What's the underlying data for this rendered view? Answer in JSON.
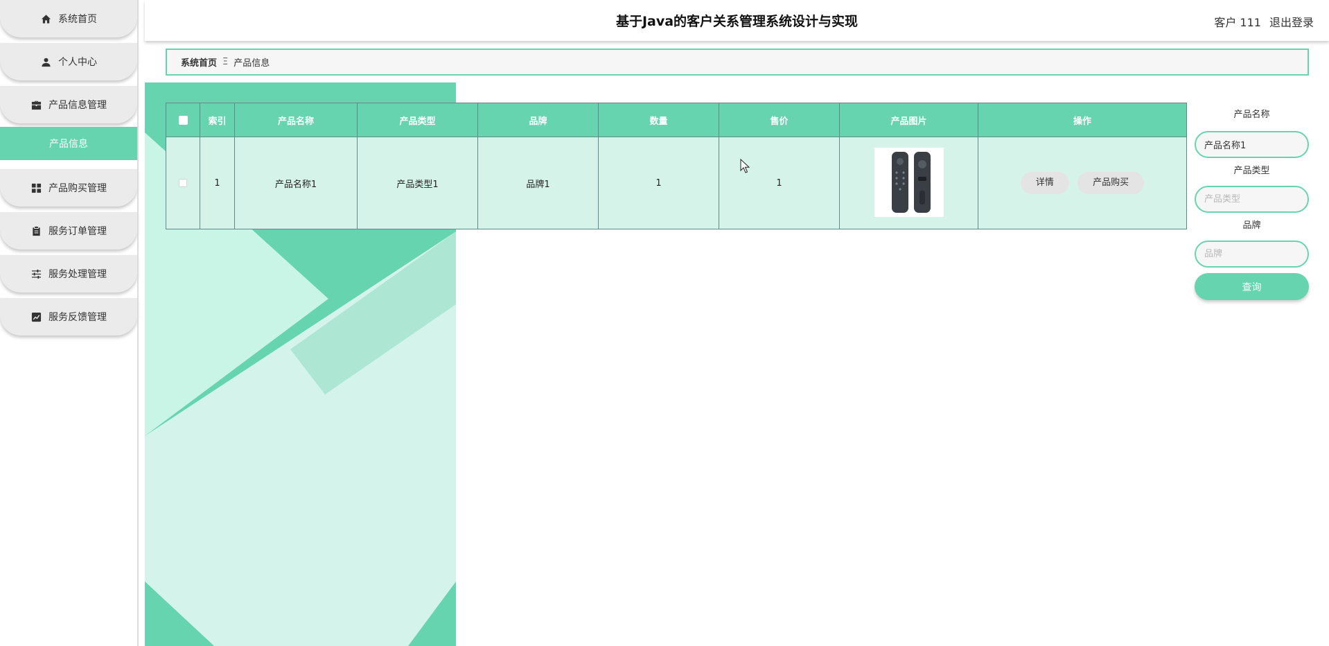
{
  "app": {
    "title": "基于Java的客户关系管理系统设计与实现",
    "user": "客户 111",
    "logout": "退出登录"
  },
  "sidebar": {
    "items": [
      {
        "label": "系统首页",
        "icon": "home-icon"
      },
      {
        "label": "个人中心",
        "icon": "person-icon"
      },
      {
        "label": "产品信息管理",
        "icon": "briefcase-icon"
      },
      {
        "label": "产品购买管理",
        "icon": "grid-icon"
      },
      {
        "label": "服务订单管理",
        "icon": "clipboard-icon"
      },
      {
        "label": "服务处理管理",
        "icon": "sliders-icon"
      },
      {
        "label": "服务反馈管理",
        "icon": "chart-icon"
      }
    ],
    "active_sub": "产品信息"
  },
  "breadcrumb": {
    "home": "系统首页",
    "separator": "Ξ",
    "current": "产品信息"
  },
  "table": {
    "headers": [
      "索引",
      "产品名称",
      "产品类型",
      "品牌",
      "数量",
      "售价",
      "产品图片",
      "操作"
    ],
    "rows": [
      {
        "index": "1",
        "name": "产品名称1",
        "type": "产品类型1",
        "brand": "品牌1",
        "quantity": "1",
        "price": "1",
        "image": "remote-control-image",
        "actions": [
          "详情",
          "产品购买"
        ]
      }
    ]
  },
  "search": {
    "name_label": "产品名称",
    "name_value": "产品名称1",
    "type_label": "产品类型",
    "type_placeholder": "产品类型",
    "brand_label": "品牌",
    "brand_placeholder": "品牌",
    "button": "查询"
  },
  "colors": {
    "accent": "#67d4b0",
    "row_bg": "#d6f3ea",
    "menu_bg": "#ebebeb"
  }
}
